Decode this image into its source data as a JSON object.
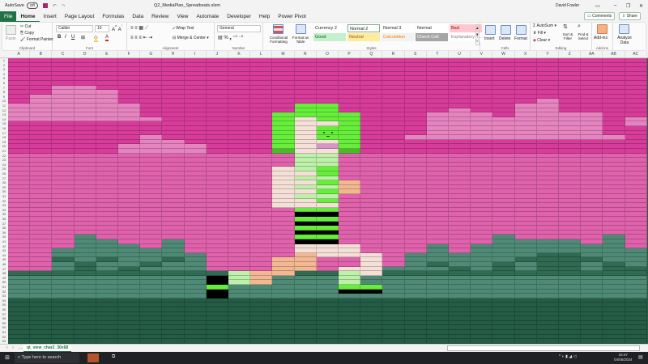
{
  "titlebar": {
    "autosave_label": "AutoSave",
    "autosave_state": "Off",
    "file_name": "Q2_MediaPlan_Spreatbeats.xlsm",
    "user_name": "David Fowler"
  },
  "tabs": [
    "File",
    "Home",
    "Insert",
    "Page Layout",
    "Formulas",
    "Data",
    "Review",
    "View",
    "Automate",
    "Developer",
    "Help",
    "Power Pivot"
  ],
  "actions": {
    "comments": "Comments",
    "share": "Share"
  },
  "ribbon": {
    "clipboard": {
      "paste": "Paste",
      "cut": "Cut",
      "copy": "Copy",
      "format_painter": "Format Painter",
      "label": "Clipboard"
    },
    "font": {
      "name": "Calibri",
      "size": "10",
      "label": "Font"
    },
    "alignment": {
      "wrap": "Wrap Text",
      "merge": "Merge & Center",
      "label": "Alignment"
    },
    "number": {
      "format": "General",
      "label": "Number"
    },
    "styles": {
      "conditional": "Conditional Formatting",
      "format_table": "Format as Table",
      "cells": [
        {
          "name": "Currency 2",
          "bg": "#ffffff",
          "fg": "#222222"
        },
        {
          "name": "Normal 2",
          "bg": "#ffffff",
          "fg": "#222222"
        },
        {
          "name": "Normal 3",
          "bg": "#ffffff",
          "fg": "#222222"
        },
        {
          "name": "Normal",
          "bg": "#ffffff",
          "fg": "#222222"
        },
        {
          "name": "Bad",
          "bg": "#ffc7ce",
          "fg": "#9c0006"
        },
        {
          "name": "Good",
          "bg": "#c6efce",
          "fg": "#006100"
        },
        {
          "name": "Neutral",
          "bg": "#ffeb9c",
          "fg": "#9c5700"
        },
        {
          "name": "Calculation",
          "bg": "#f2f2f2",
          "fg": "#fa7d00"
        },
        {
          "name": "Check Cell",
          "bg": "#a5a5a5",
          "fg": "#ffffff"
        },
        {
          "name": "Explanatory T...",
          "bg": "#ffffff",
          "fg": "#7f7f7f"
        }
      ],
      "label": "Styles"
    },
    "cells": {
      "insert": "Insert",
      "delete": "Delete",
      "format": "Format",
      "label": "Cells"
    },
    "editing": {
      "autosum": "AutoSum",
      "fill": "Fill",
      "clear": "Clear",
      "sort": "Sort & Filter",
      "find": "Find & Select",
      "label": "Editing"
    },
    "addins": {
      "addins": "Add-ins",
      "label": "Add-ins"
    },
    "analyze": {
      "label": "Analyze Data"
    }
  },
  "columns": [
    "A",
    "B",
    "C",
    "D",
    "E",
    "F",
    "G",
    "H",
    "I",
    "J",
    "K",
    "L",
    "M",
    "N",
    "O",
    "P",
    "Q",
    "R",
    "S",
    "T",
    "U",
    "V",
    "W",
    "X",
    "Y",
    "Z",
    "AA",
    "AB",
    "AC"
  ],
  "row_count": 63,
  "palette": {
    "p": "#d83c9a",
    "q": "#e062ac",
    "c": "#e684c0",
    "t": "#4f8a76",
    "d": "#2f6a52",
    "g": "#245c46",
    "G": "#66ee3a",
    "D": "#4fb62e",
    "s": "#f5e0d8",
    "l": "#bdf0a8",
    "k": "#000000",
    "o": "#f2b892",
    "w": "#d894c8"
  },
  "sheet_fill": {
    "base_rows": [
      [
        1,
        21,
        "p"
      ],
      [
        22,
        47,
        "q"
      ],
      [
        48,
        48,
        "d"
      ],
      [
        49,
        53,
        "t"
      ],
      [
        54,
        63,
        "g"
      ]
    ],
    "regions": [
      [
        7,
        7,
        2,
        3,
        "c"
      ],
      [
        8,
        8,
        2,
        4,
        "c"
      ],
      [
        9,
        10,
        1,
        4,
        "c"
      ],
      [
        11,
        13,
        0,
        5,
        "c"
      ],
      [
        14,
        14,
        0,
        6,
        "c"
      ],
      [
        18,
        18,
        6,
        6,
        "c"
      ],
      [
        19,
        19,
        6,
        7,
        "c"
      ],
      [
        20,
        21,
        5,
        8,
        "c"
      ],
      [
        12,
        12,
        20,
        20,
        "c"
      ],
      [
        13,
        17,
        19,
        21,
        "c"
      ],
      [
        14,
        17,
        22,
        22,
        "c"
      ],
      [
        10,
        10,
        24,
        24,
        "c"
      ],
      [
        11,
        12,
        23,
        24,
        "c"
      ],
      [
        13,
        17,
        23,
        26,
        "c"
      ],
      [
        18,
        18,
        18,
        27,
        "c"
      ],
      [
        14,
        15,
        28,
        28,
        "c"
      ],
      [
        43,
        47,
        2,
        2,
        "t"
      ],
      [
        40,
        47,
        3,
        3,
        "t"
      ],
      [
        41,
        47,
        4,
        4,
        "t"
      ],
      [
        42,
        47,
        5,
        5,
        "t"
      ],
      [
        43,
        47,
        6,
        6,
        "t"
      ],
      [
        41,
        47,
        7,
        7,
        "t"
      ],
      [
        44,
        47,
        8,
        8,
        "t"
      ],
      [
        47,
        47,
        17,
        17,
        "t"
      ],
      [
        44,
        47,
        18,
        18,
        "t"
      ],
      [
        42,
        47,
        19,
        19,
        "t"
      ],
      [
        44,
        47,
        20,
        20,
        "t"
      ],
      [
        42,
        47,
        21,
        21,
        "t"
      ],
      [
        40,
        47,
        22,
        22,
        "t"
      ],
      [
        41,
        47,
        23,
        25,
        "t"
      ],
      [
        42,
        47,
        26,
        26,
        "t"
      ],
      [
        40,
        47,
        27,
        27,
        "t"
      ],
      [
        43,
        47,
        28,
        28,
        "t"
      ],
      [
        45,
        45,
        2,
        2,
        "d"
      ],
      [
        46,
        47,
        3,
        3,
        "d"
      ],
      [
        45,
        45,
        4,
        4,
        "d"
      ],
      [
        47,
        47,
        5,
        5,
        "d"
      ],
      [
        46,
        46,
        6,
        6,
        "d"
      ],
      [
        45,
        45,
        7,
        7,
        "d"
      ],
      [
        46,
        46,
        19,
        19,
        "d"
      ],
      [
        47,
        47,
        20,
        20,
        "d"
      ],
      [
        46,
        47,
        22,
        22,
        "d"
      ],
      [
        45,
        45,
        23,
        23,
        "d"
      ],
      [
        44,
        47,
        24,
        25,
        "d"
      ],
      [
        45,
        45,
        26,
        26,
        "d"
      ],
      [
        46,
        47,
        27,
        27,
        "d"
      ],
      [
        47,
        47,
        28,
        28,
        "d"
      ],
      [
        11,
        12,
        13,
        14,
        "G"
      ],
      [
        13,
        20,
        12,
        15,
        "G"
      ],
      [
        14,
        20,
        13,
        13,
        "s"
      ],
      [
        15,
        15,
        14,
        14,
        "s"
      ],
      [
        19,
        19,
        14,
        14,
        "s"
      ],
      [
        20,
        20,
        14,
        14,
        "w"
      ],
      [
        21,
        21,
        12,
        12,
        "D"
      ],
      [
        21,
        21,
        15,
        15,
        "D"
      ],
      [
        21,
        21,
        13,
        14,
        "s"
      ],
      [
        22,
        24,
        13,
        14,
        "l"
      ],
      [
        25,
        33,
        12,
        12,
        "s"
      ],
      [
        25,
        33,
        13,
        13,
        "l"
      ],
      [
        25,
        33,
        14,
        14,
        "G"
      ],
      [
        26,
        26,
        13,
        13,
        "s"
      ],
      [
        28,
        28,
        13,
        13,
        "s"
      ],
      [
        30,
        30,
        13,
        13,
        "s"
      ],
      [
        32,
        32,
        13,
        13,
        "s"
      ],
      [
        27,
        27,
        14,
        14,
        "l"
      ],
      [
        29,
        29,
        14,
        14,
        "l"
      ],
      [
        31,
        31,
        14,
        14,
        "l"
      ],
      [
        28,
        30,
        15,
        15,
        "o"
      ],
      [
        33,
        33,
        13,
        14,
        "s"
      ],
      [
        34,
        41,
        13,
        14,
        "G"
      ],
      [
        35,
        35,
        13,
        14,
        "k"
      ],
      [
        37,
        37,
        13,
        14,
        "k"
      ],
      [
        39,
        39,
        13,
        14,
        "k"
      ],
      [
        41,
        41,
        13,
        14,
        "k"
      ],
      [
        42,
        43,
        13,
        15,
        "s"
      ],
      [
        44,
        44,
        13,
        13,
        "o"
      ],
      [
        44,
        44,
        14,
        16,
        "s"
      ],
      [
        45,
        47,
        12,
        13,
        "o"
      ],
      [
        47,
        47,
        15,
        15,
        "s"
      ],
      [
        45,
        48,
        16,
        16,
        "s"
      ],
      [
        48,
        48,
        12,
        12,
        "o"
      ],
      [
        48,
        50,
        10,
        10,
        "l"
      ],
      [
        48,
        50,
        11,
        11,
        "o"
      ],
      [
        49,
        50,
        9,
        9,
        "k"
      ],
      [
        51,
        51,
        9,
        9,
        "G"
      ],
      [
        52,
        53,
        9,
        9,
        "k"
      ],
      [
        48,
        50,
        15,
        15,
        "l"
      ],
      [
        51,
        51,
        15,
        16,
        "G"
      ],
      [
        52,
        52,
        15,
        16,
        "k"
      ]
    ]
  },
  "sheet_tabs": {
    "active": "qt_view_char2_30x68"
  },
  "taskbar": {
    "search_placeholder": "Type here to search",
    "time": "16:47",
    "date": "04/05/2024"
  }
}
